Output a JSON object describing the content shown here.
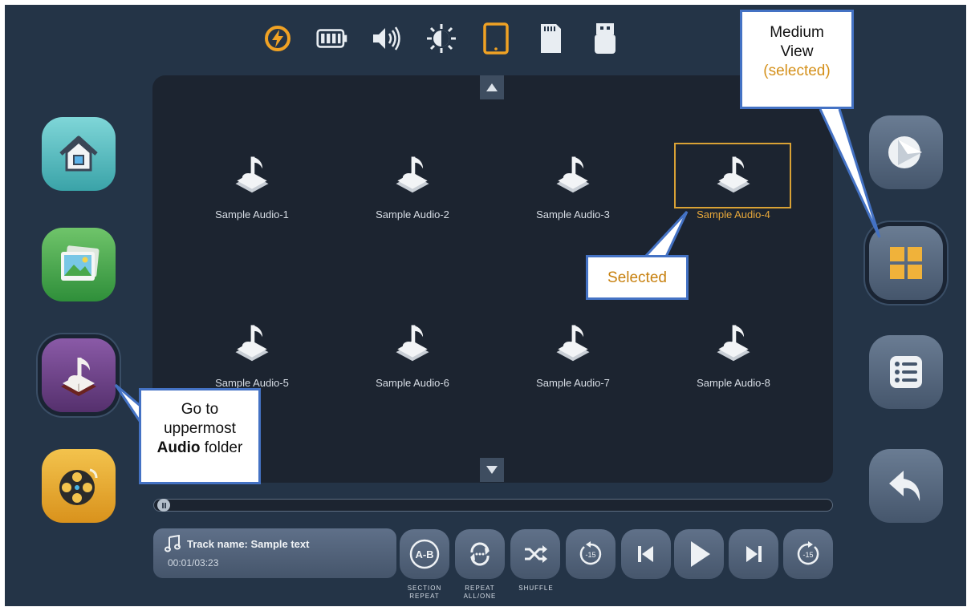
{
  "status_icons": [
    "charging-icon",
    "battery-icon",
    "volume-icon",
    "brightness-icon",
    "tablet-icon",
    "sd-card-icon",
    "usb-icon"
  ],
  "colors": {
    "accent": "#e8a83a",
    "background": "#243447",
    "panel": "#1c2430",
    "callout_border": "#4472c4"
  },
  "audio_items": [
    {
      "label": "Sample Audio-1",
      "selected": false
    },
    {
      "label": "Sample Audio-2",
      "selected": false
    },
    {
      "label": "Sample Audio-3",
      "selected": false
    },
    {
      "label": "Sample Audio-4",
      "selected": true
    },
    {
      "label": "Sample Audio-5",
      "selected": false
    },
    {
      "label": "Sample Audio-6",
      "selected": false
    },
    {
      "label": "Sample Audio-7",
      "selected": false
    },
    {
      "label": "Sample Audio-8",
      "selected": false
    }
  ],
  "player": {
    "track_name": "Track name: Sample text",
    "time": "00:01/03:23",
    "progress": 0.0
  },
  "controls": {
    "ab_text": "A-B",
    "section_repeat_line1": "SECTION",
    "section_repeat_line2": "REPEAT",
    "repeat_line1": "REPEAT",
    "repeat_line2": "ALL/ONE",
    "shuffle_label": "SHUFFLE",
    "rewind_text": "-15",
    "forward_text": "-15"
  },
  "callouts": {
    "medium_line1": "Medium",
    "medium_line2": "View",
    "medium_line3": "(selected)",
    "selected": "Selected",
    "audio_line1": "Go to",
    "audio_line2": "uppermost",
    "audio_bold": "Audio",
    "audio_rest": " folder"
  }
}
